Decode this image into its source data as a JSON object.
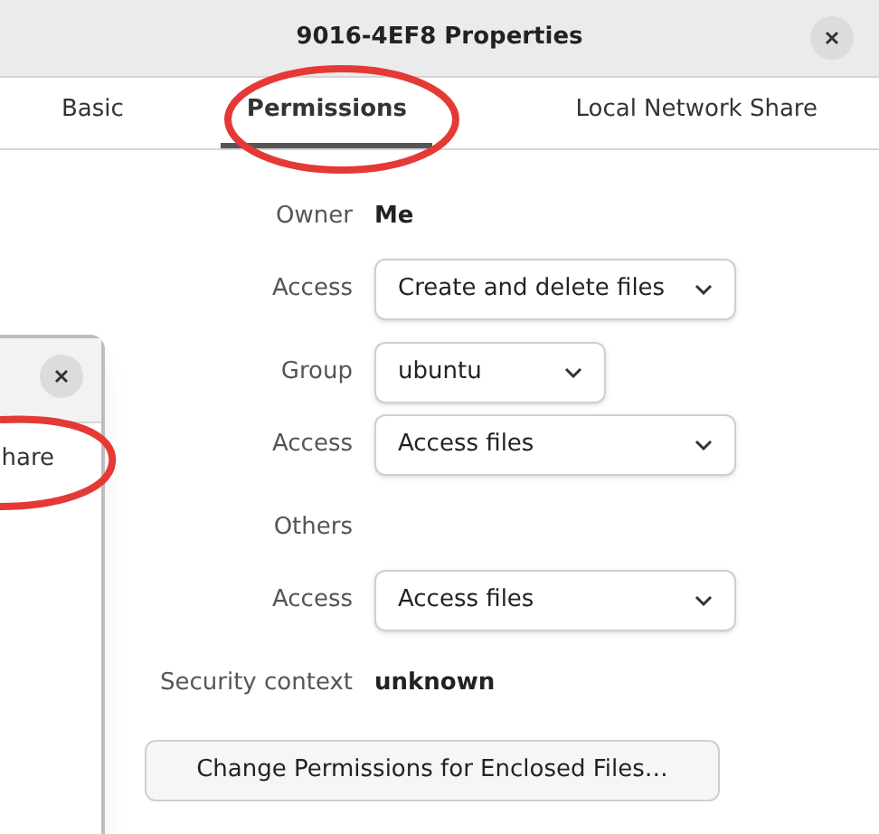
{
  "window": {
    "title": "9016-4EF8 Properties"
  },
  "tabs": [
    {
      "label": "Basic",
      "selected": false
    },
    {
      "label": "Permissions",
      "selected": true
    },
    {
      "label": "Local Network Share",
      "selected": false
    }
  ],
  "sections": [
    {
      "rows": [
        {
          "kind": "text",
          "label": "Owner",
          "value": "Me"
        },
        {
          "kind": "dropdown",
          "label": "Access",
          "value": "Create and delete files"
        }
      ]
    },
    {
      "rows": [
        {
          "kind": "short_dropdown",
          "label": "Group",
          "value": "ubuntu"
        },
        {
          "kind": "dropdown",
          "label": "Access",
          "value": "Access files"
        }
      ]
    },
    {
      "rows": [
        {
          "kind": "heading",
          "label": "Others"
        },
        {
          "kind": "dropdown",
          "label": "Access",
          "value": "Access files"
        }
      ]
    },
    {
      "rows": [
        {
          "kind": "text",
          "label": "Security context",
          "value": "unknown"
        }
      ]
    }
  ],
  "button": "Change Permissions for Enclosed Files…",
  "background_window": {
    "tab_fragment": "hare"
  }
}
